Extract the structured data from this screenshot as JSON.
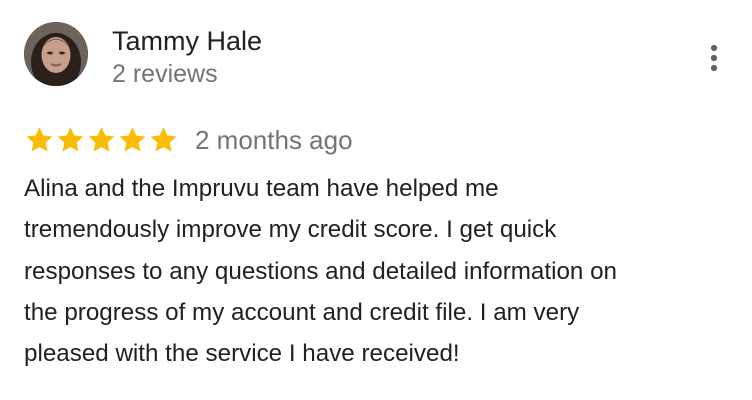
{
  "review": {
    "reviewer_name": "Tammy Hale",
    "review_count": "2 reviews",
    "rating": 5,
    "rating_max": 5,
    "time_ago": "2 months ago",
    "text_lines": [
      "Alina and the Impruvu team have helped me",
      "tremendously improve my credit score. I get quick",
      "responses to any questions and detailed information on",
      "the progress of my account and credit file. I am very",
      "pleased with the service I have received!"
    ]
  },
  "icons": {
    "star": "star-icon",
    "more": "more-vert-icon"
  },
  "colors": {
    "star": "#FBBC04",
    "name": "#202124",
    "secondary": "#70757A",
    "more_icon": "#5F6368"
  }
}
